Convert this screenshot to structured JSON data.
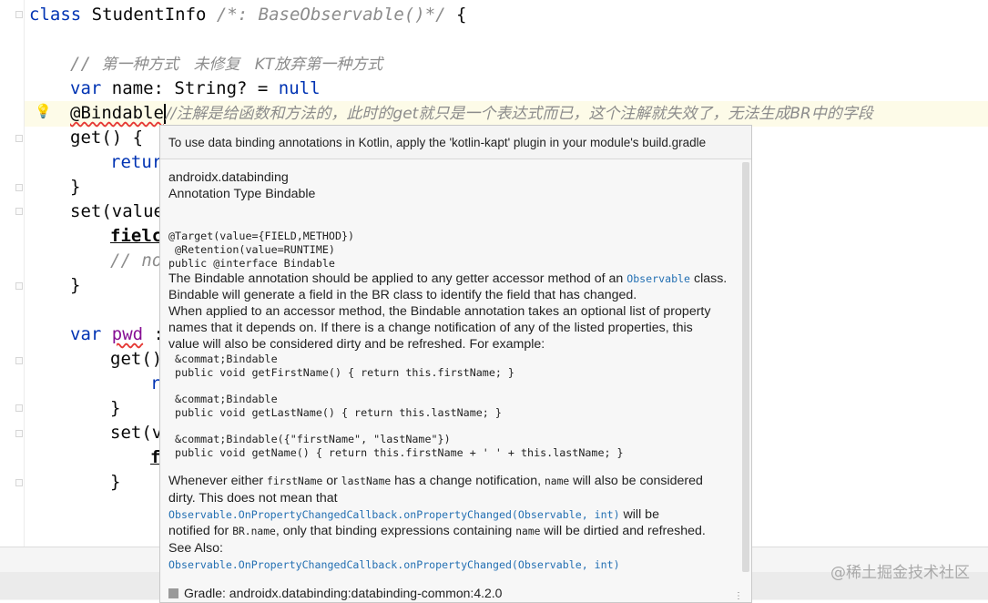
{
  "editor": {
    "line1": {
      "kw": "class",
      "name": " StudentInfo ",
      "comment": "/*: BaseObservable()*/",
      "brace": " {"
    },
    "comment_line": {
      "slashes": "// ",
      "text": "第一种方式   未修复   KT放弃第一种方式"
    },
    "var_line": {
      "kw": "var",
      "rest": " name: String? = ",
      "null": "null"
    },
    "ann_line": {
      "ann": "@Bindable",
      "comment": "//注解是给函数和方法的，此时的get就只是一个表达式而已，这个注解就失效了，无法生成BR中的字段"
    },
    "get_line": "get() {",
    "return_line": "retur",
    "close1": "}",
    "set_line": "set(value",
    "field_line": "fielc",
    "comment_no": "// no",
    "close2": "}",
    "pwd_line": {
      "kw": "var",
      "name": "pwd",
      "rest": " :"
    },
    "get2_line": "get()",
    "r_line": "r",
    "close3": "}",
    "set2_line": "set(v",
    "f_line": "f",
    "close4": "}"
  },
  "popup": {
    "header": "To use data binding annotations in Kotlin, apply the 'kotlin-kapt' plugin in your module's build.gradle",
    "package": "androidx.databinding",
    "type": "Annotation Type Bindable",
    "target": "@Target(value={FIELD,METHOD})",
    "retention": " @Retention(value=RUNTIME)",
    "decl": "public @interface Bindable",
    "desc1_a": "The Bindable annotation should be applied to any getter accessor method of an ",
    "desc1_link": "Observable",
    "desc1_b": " class.",
    "desc2": "Bindable will generate a field in the BR class to identify the field that has changed.",
    "desc3": "When applied to an accessor method, the Bindable annotation takes an optional list of property",
    "desc4": "names that it depends on. If there is a change notification of any of the listed properties, this",
    "desc5": "value will also be considered dirty and be refreshed. For example:",
    "code1a": " &commat;Bindable",
    "code1b": " public void getFirstName() { return this.firstName; }",
    "code2a": " &commat;Bindable",
    "code2b": " public void getLastName() { return this.lastName; }",
    "code3a": " &commat;Bindable({\"firstName\", \"lastName\"})",
    "code3b": " public void getName() { return this.firstName + ' ' + this.lastName; }",
    "when_a": "Whenever either ",
    "when_c1": "firstName",
    "when_b": " or ",
    "when_c2": "lastName",
    "when_c": " has a change notification, ",
    "when_c3": "name",
    "when_d": " will also be considered",
    "dirty": "dirty. This does not mean that",
    "link1": "Observable.OnPropertyChangedCallback.onPropertyChanged(Observable, int)",
    "link1_after": " will be",
    "notified_a": "notified for ",
    "notified_code": "BR.name",
    "notified_b": ", only that binding expressions containing ",
    "notified_code2": "name",
    "notified_c": " will be dirtied and refreshed.",
    "see_also": "See Also:",
    "link2": "Observable.OnPropertyChangedCallback.onPropertyChanged(Observable, int)",
    "gradle": "Gradle: androidx.databinding:databinding-common:4.2.0",
    "more": "⋮"
  },
  "watermark": "@稀土掘金技术社区",
  "icons": {
    "bulb": "💡"
  }
}
